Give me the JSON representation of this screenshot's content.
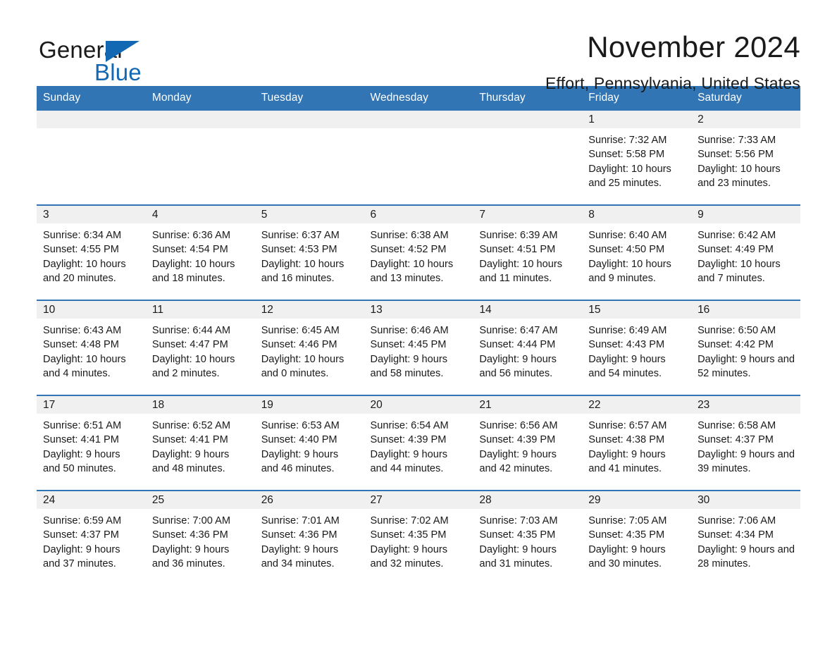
{
  "brand": {
    "name_part1": "General",
    "name_part2": "Blue",
    "accent_color": "#1268b3"
  },
  "header": {
    "title": "November 2024",
    "location": "Effort, Pennsylvania, United States"
  },
  "theme": {
    "header_bar_color": "#3175b4",
    "daynum_band_color": "#f0f0f0",
    "row_divider_color": "#3175b4"
  },
  "weekday_headers": [
    "Sunday",
    "Monday",
    "Tuesday",
    "Wednesday",
    "Thursday",
    "Friday",
    "Saturday"
  ],
  "labels": {
    "sunrise_prefix": "Sunrise:",
    "sunset_prefix": "Sunset:",
    "daylight_prefix": "Daylight:"
  },
  "weeks": [
    [
      {
        "empty": true
      },
      {
        "empty": true
      },
      {
        "empty": true
      },
      {
        "empty": true
      },
      {
        "empty": true
      },
      {
        "empty": false,
        "day": "1",
        "sunrise": "Sunrise: 7:32 AM",
        "sunset": "Sunset: 5:58 PM",
        "daylight": "Daylight: 10 hours and 25 minutes."
      },
      {
        "empty": false,
        "day": "2",
        "sunrise": "Sunrise: 7:33 AM",
        "sunset": "Sunset: 5:56 PM",
        "daylight": "Daylight: 10 hours and 23 minutes."
      }
    ],
    [
      {
        "empty": false,
        "day": "3",
        "sunrise": "Sunrise: 6:34 AM",
        "sunset": "Sunset: 4:55 PM",
        "daylight": "Daylight: 10 hours and 20 minutes."
      },
      {
        "empty": false,
        "day": "4",
        "sunrise": "Sunrise: 6:36 AM",
        "sunset": "Sunset: 4:54 PM",
        "daylight": "Daylight: 10 hours and 18 minutes."
      },
      {
        "empty": false,
        "day": "5",
        "sunrise": "Sunrise: 6:37 AM",
        "sunset": "Sunset: 4:53 PM",
        "daylight": "Daylight: 10 hours and 16 minutes."
      },
      {
        "empty": false,
        "day": "6",
        "sunrise": "Sunrise: 6:38 AM",
        "sunset": "Sunset: 4:52 PM",
        "daylight": "Daylight: 10 hours and 13 minutes."
      },
      {
        "empty": false,
        "day": "7",
        "sunrise": "Sunrise: 6:39 AM",
        "sunset": "Sunset: 4:51 PM",
        "daylight": "Daylight: 10 hours and 11 minutes."
      },
      {
        "empty": false,
        "day": "8",
        "sunrise": "Sunrise: 6:40 AM",
        "sunset": "Sunset: 4:50 PM",
        "daylight": "Daylight: 10 hours and 9 minutes."
      },
      {
        "empty": false,
        "day": "9",
        "sunrise": "Sunrise: 6:42 AM",
        "sunset": "Sunset: 4:49 PM",
        "daylight": "Daylight: 10 hours and 7 minutes."
      }
    ],
    [
      {
        "empty": false,
        "day": "10",
        "sunrise": "Sunrise: 6:43 AM",
        "sunset": "Sunset: 4:48 PM",
        "daylight": "Daylight: 10 hours and 4 minutes."
      },
      {
        "empty": false,
        "day": "11",
        "sunrise": "Sunrise: 6:44 AM",
        "sunset": "Sunset: 4:47 PM",
        "daylight": "Daylight: 10 hours and 2 minutes."
      },
      {
        "empty": false,
        "day": "12",
        "sunrise": "Sunrise: 6:45 AM",
        "sunset": "Sunset: 4:46 PM",
        "daylight": "Daylight: 10 hours and 0 minutes."
      },
      {
        "empty": false,
        "day": "13",
        "sunrise": "Sunrise: 6:46 AM",
        "sunset": "Sunset: 4:45 PM",
        "daylight": "Daylight: 9 hours and 58 minutes."
      },
      {
        "empty": false,
        "day": "14",
        "sunrise": "Sunrise: 6:47 AM",
        "sunset": "Sunset: 4:44 PM",
        "daylight": "Daylight: 9 hours and 56 minutes."
      },
      {
        "empty": false,
        "day": "15",
        "sunrise": "Sunrise: 6:49 AM",
        "sunset": "Sunset: 4:43 PM",
        "daylight": "Daylight: 9 hours and 54 minutes."
      },
      {
        "empty": false,
        "day": "16",
        "sunrise": "Sunrise: 6:50 AM",
        "sunset": "Sunset: 4:42 PM",
        "daylight": "Daylight: 9 hours and 52 minutes."
      }
    ],
    [
      {
        "empty": false,
        "day": "17",
        "sunrise": "Sunrise: 6:51 AM",
        "sunset": "Sunset: 4:41 PM",
        "daylight": "Daylight: 9 hours and 50 minutes."
      },
      {
        "empty": false,
        "day": "18",
        "sunrise": "Sunrise: 6:52 AM",
        "sunset": "Sunset: 4:41 PM",
        "daylight": "Daylight: 9 hours and 48 minutes."
      },
      {
        "empty": false,
        "day": "19",
        "sunrise": "Sunrise: 6:53 AM",
        "sunset": "Sunset: 4:40 PM",
        "daylight": "Daylight: 9 hours and 46 minutes."
      },
      {
        "empty": false,
        "day": "20",
        "sunrise": "Sunrise: 6:54 AM",
        "sunset": "Sunset: 4:39 PM",
        "daylight": "Daylight: 9 hours and 44 minutes."
      },
      {
        "empty": false,
        "day": "21",
        "sunrise": "Sunrise: 6:56 AM",
        "sunset": "Sunset: 4:39 PM",
        "daylight": "Daylight: 9 hours and 42 minutes."
      },
      {
        "empty": false,
        "day": "22",
        "sunrise": "Sunrise: 6:57 AM",
        "sunset": "Sunset: 4:38 PM",
        "daylight": "Daylight: 9 hours and 41 minutes."
      },
      {
        "empty": false,
        "day": "23",
        "sunrise": "Sunrise: 6:58 AM",
        "sunset": "Sunset: 4:37 PM",
        "daylight": "Daylight: 9 hours and 39 minutes."
      }
    ],
    [
      {
        "empty": false,
        "day": "24",
        "sunrise": "Sunrise: 6:59 AM",
        "sunset": "Sunset: 4:37 PM",
        "daylight": "Daylight: 9 hours and 37 minutes."
      },
      {
        "empty": false,
        "day": "25",
        "sunrise": "Sunrise: 7:00 AM",
        "sunset": "Sunset: 4:36 PM",
        "daylight": "Daylight: 9 hours and 36 minutes."
      },
      {
        "empty": false,
        "day": "26",
        "sunrise": "Sunrise: 7:01 AM",
        "sunset": "Sunset: 4:36 PM",
        "daylight": "Daylight: 9 hours and 34 minutes."
      },
      {
        "empty": false,
        "day": "27",
        "sunrise": "Sunrise: 7:02 AM",
        "sunset": "Sunset: 4:35 PM",
        "daylight": "Daylight: 9 hours and 32 minutes."
      },
      {
        "empty": false,
        "day": "28",
        "sunrise": "Sunrise: 7:03 AM",
        "sunset": "Sunset: 4:35 PM",
        "daylight": "Daylight: 9 hours and 31 minutes."
      },
      {
        "empty": false,
        "day": "29",
        "sunrise": "Sunrise: 7:05 AM",
        "sunset": "Sunset: 4:35 PM",
        "daylight": "Daylight: 9 hours and 30 minutes."
      },
      {
        "empty": false,
        "day": "30",
        "sunrise": "Sunrise: 7:06 AM",
        "sunset": "Sunset: 4:34 PM",
        "daylight": "Daylight: 9 hours and 28 minutes."
      }
    ]
  ]
}
